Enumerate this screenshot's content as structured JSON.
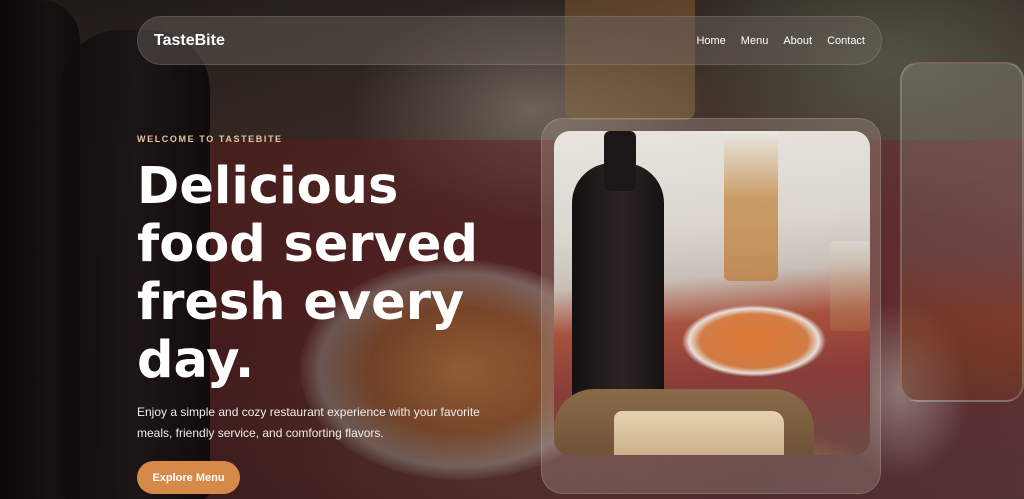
{
  "brand": "TasteBite",
  "nav": {
    "links": [
      {
        "label": "Home"
      },
      {
        "label": "Menu"
      },
      {
        "label": "About"
      },
      {
        "label": "Contact"
      }
    ]
  },
  "hero": {
    "eyebrow": "WELCOME TO TASTEBITE",
    "headline": "Delicious food served fresh every day.",
    "subtitle": "Enjoy a simple and cozy restaurant experience with your favorite meals, friendly service, and comforting flavors.",
    "cta_label": "Explore Menu"
  },
  "colors": {
    "accent": "#d58a4a",
    "eyebrow": "#e8c4a0",
    "text": "#ffffff"
  }
}
